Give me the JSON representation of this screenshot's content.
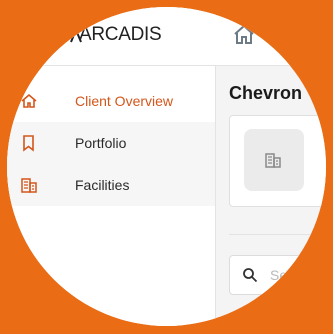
{
  "brand": {
    "logo_text": "ARCADIS",
    "accent": "#d4561b",
    "background": "#ea6c14"
  },
  "sidebar": {
    "items": [
      {
        "label": "Client Overview",
        "icon": "home-outline-icon",
        "active": true
      },
      {
        "label": "Portfolio",
        "icon": "bookmark-icon",
        "active": false
      },
      {
        "label": "Facilities",
        "icon": "building-icon",
        "active": false
      }
    ]
  },
  "header": {
    "icon": "home-icon"
  },
  "main": {
    "client_name": "Chevron",
    "card": {
      "icon": "building-icon"
    },
    "search": {
      "placeholder": "Search"
    }
  }
}
